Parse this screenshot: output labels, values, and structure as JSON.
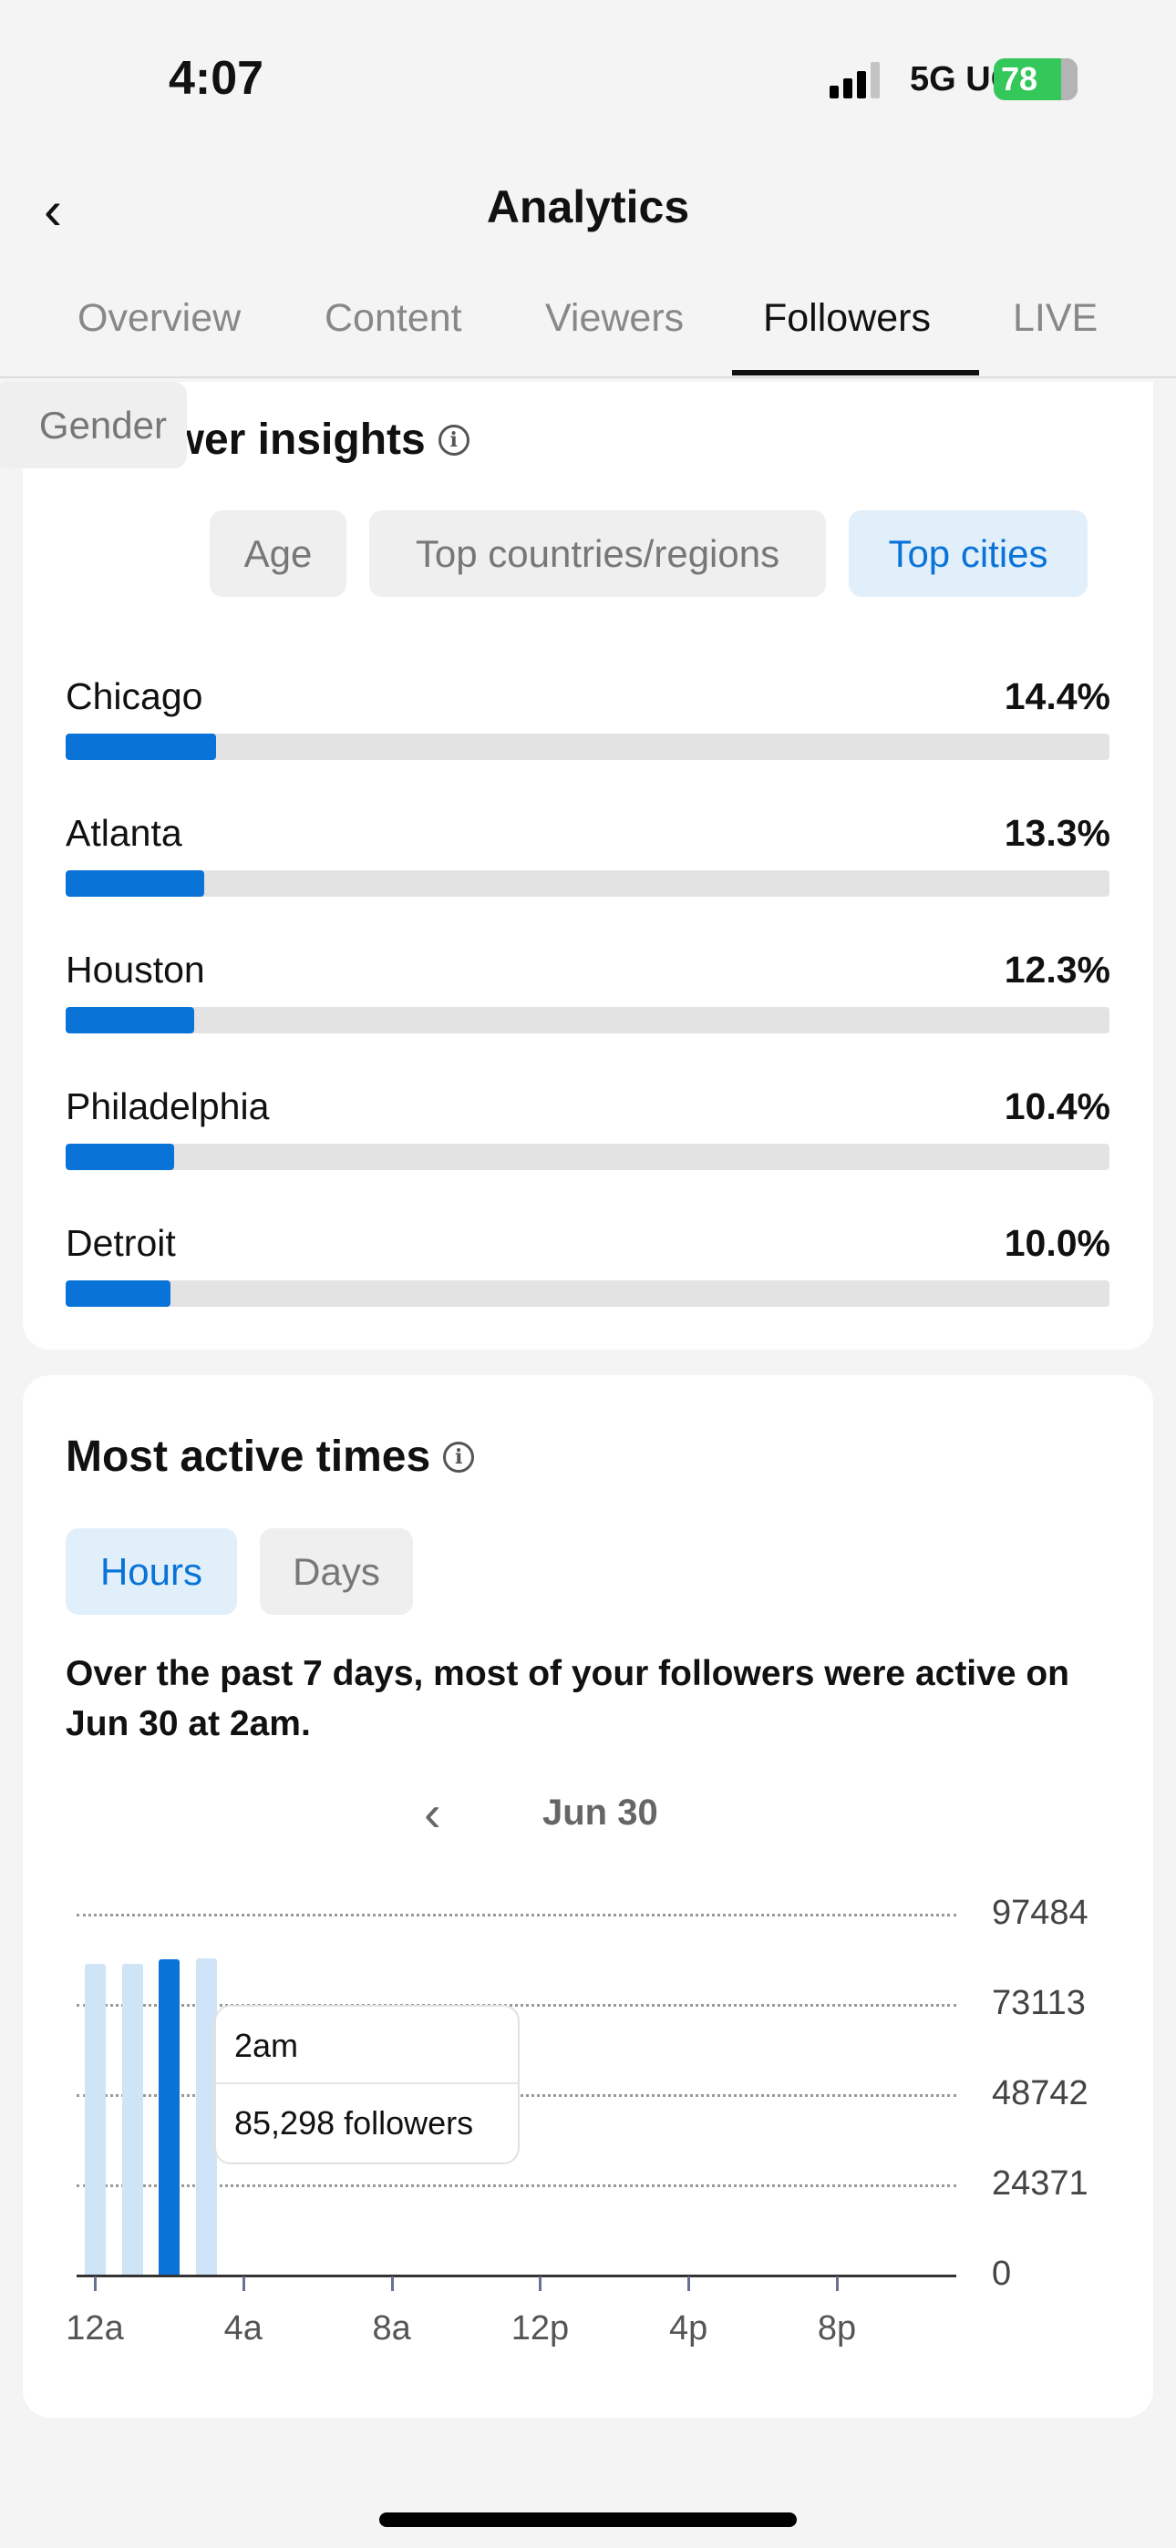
{
  "status_bar": {
    "time": "4:07",
    "network": "5G UC",
    "battery": "78"
  },
  "header": {
    "title": "Analytics",
    "back_icon": "chevron-left-icon"
  },
  "tabs": [
    {
      "label": "Overview"
    },
    {
      "label": "Content"
    },
    {
      "label": "Viewers"
    },
    {
      "label": "Followers",
      "active": true
    },
    {
      "label": "LIVE"
    }
  ],
  "insights": {
    "title": "Follower insights",
    "filters": [
      {
        "label": "Gender"
      },
      {
        "label": "Age"
      },
      {
        "label": "Top countries/regions"
      },
      {
        "label": "Top cities",
        "active": true
      }
    ],
    "cities": [
      {
        "name": "Chicago",
        "pct_label": "14.4%",
        "pct": 14.4
      },
      {
        "name": "Atlanta",
        "pct_label": "13.3%",
        "pct": 13.3
      },
      {
        "name": "Houston",
        "pct_label": "12.3%",
        "pct": 12.3
      },
      {
        "name": "Philadelphia",
        "pct_label": "10.4%",
        "pct": 10.4
      },
      {
        "name": "Detroit",
        "pct_label": "10.0%",
        "pct": 10.0
      }
    ]
  },
  "active_times": {
    "title": "Most active times",
    "toggles": [
      {
        "label": "Hours",
        "active": true
      },
      {
        "label": "Days"
      }
    ],
    "summary": "Over the past 7 days, most of your followers were active on Jun 30 at 2am.",
    "date": "Jun 30",
    "tooltip": {
      "label": "2am",
      "value": "85,298 followers"
    }
  },
  "colors": {
    "accent": "#0a73d8",
    "bar_light": "#cfe4f7",
    "battery": "#34c759"
  },
  "chart_data": {
    "type": "bar",
    "x_tick_labels": [
      "12a",
      "4a",
      "8a",
      "12p",
      "4p",
      "8p"
    ],
    "y_tick_labels": [
      "97484",
      "73113",
      "48742",
      "24371",
      "0"
    ],
    "ylim": [
      0,
      97484
    ],
    "grid": true,
    "hours": [
      0,
      1,
      2,
      3
    ],
    "values": [
      84000,
      84000,
      85298,
      85400
    ],
    "highlighted_hour": 2
  }
}
